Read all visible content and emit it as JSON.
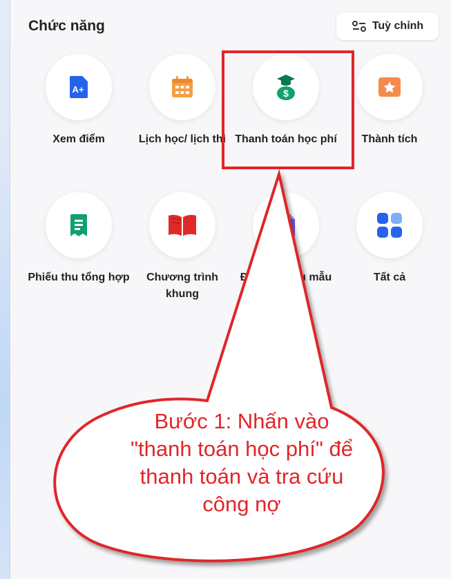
{
  "header": {
    "title": "Chức năng",
    "customize_label": "Tuỳ chỉnh"
  },
  "tiles": [
    {
      "label": "Xem điểm",
      "icon": "grade-report-icon",
      "color": "#2563eb"
    },
    {
      "label": "Lịch học/ lịch thi",
      "icon": "calendar-icon",
      "color": "#f59e42"
    },
    {
      "label": "Thanh toán học phí",
      "icon": "tuition-payment-icon",
      "color": "#10a36b"
    },
    {
      "label": "Thành tích",
      "icon": "achievement-icon",
      "color": "#f58a4b"
    },
    {
      "label": "Phiếu thu tổng hợp",
      "icon": "receipt-icon",
      "color": "#12a06a"
    },
    {
      "label": "Chương trình khung",
      "icon": "book-icon",
      "color": "#e02a2a"
    },
    {
      "label": "Đề xuất biểu mẫu",
      "icon": "form-document-icon",
      "color": "#6b5cf0"
    },
    {
      "label": "Tất cả",
      "icon": "apps-grid-icon",
      "color": "#2563eb"
    }
  ],
  "callout": {
    "lines": [
      "Bước 1: Nhấn vào",
      "\"thanh toán học phí\" để",
      "thanh toán và tra cứu",
      "công nợ"
    ]
  }
}
